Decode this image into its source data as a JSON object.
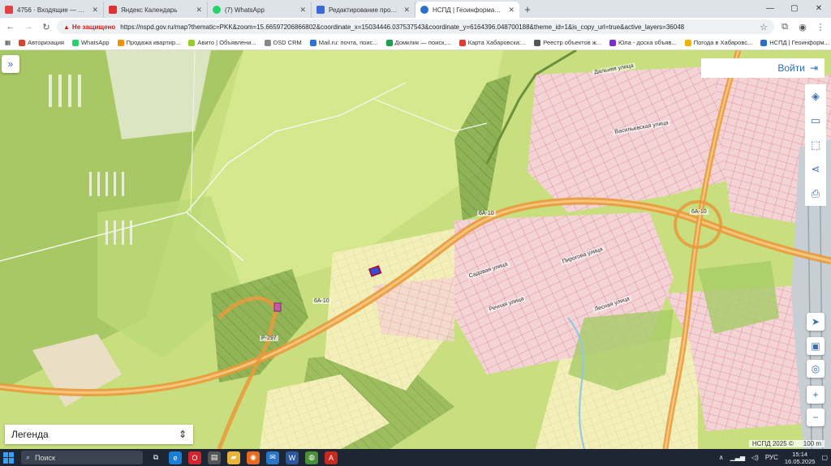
{
  "tabs": [
    {
      "title": "4756 · Входящие — Яндекс По",
      "color": "#e04040"
    },
    {
      "title": "Яндекс Календарь",
      "color": "#e03030"
    },
    {
      "title": "(7) WhatsApp",
      "color": "#25d366"
    },
    {
      "title": "Редактирование продавца сэ",
      "color": "#3b6ad8"
    },
    {
      "title": "НСПД | Геоинформационный",
      "color": "#2a6fc9"
    }
  ],
  "window_controls": {
    "minimize": "—",
    "maximize": "▢",
    "close": "✕"
  },
  "address": {
    "insecure_label": "Не защищено",
    "url": "https://nspd.gov.ru/map?thematic=PKK&zoom=15.66597206866802&coordinate_x=15034446.037537543&coordinate_y=6164396.048700188&theme_id=1&is_copy_url=true&active_layers=36048"
  },
  "bookmarks": [
    {
      "label": "Авторизация",
      "color": "#d9452b"
    },
    {
      "label": "WhatsApp",
      "color": "#25d366"
    },
    {
      "label": "Продажа квартир...",
      "color": "#f29100"
    },
    {
      "label": "Авито | Объявлени...",
      "color": "#97cf26"
    },
    {
      "label": "DSD CRM",
      "color": "#888888"
    },
    {
      "label": "Mail.ru: почта, поис...",
      "color": "#2a73d6"
    },
    {
      "label": "Домклик — поиск,...",
      "color": "#16a34a"
    },
    {
      "label": "Карта Хабаровска:...",
      "color": "#e53935"
    },
    {
      "label": "Реестр объектов ж...",
      "color": "#555555"
    },
    {
      "label": "Юла - доска объяв...",
      "color": "#7b2cd6"
    },
    {
      "label": "Погода в Хабаровс...",
      "color": "#f4b400"
    },
    {
      "label": "НСПД | Геоинформ...",
      "color": "#2a6fc9"
    }
  ],
  "map": {
    "login_label": "Войти",
    "legend_label": "Легенда",
    "copyright": "НСПД 2025 ©",
    "scale": "100 m",
    "road_labels": [
      "6А-10",
      "6А-10",
      "Р-297",
      "6А-10"
    ],
    "street_labels": [
      "Садовая улица",
      "Пирогова улица",
      "Речная улица",
      "Лесная улица",
      "Васильевская улица",
      "Дальняя улица"
    ]
  },
  "taskbar": {
    "search_placeholder": "Поиск",
    "language": "РУС",
    "time": "15:14",
    "date": "16.05.2025"
  }
}
